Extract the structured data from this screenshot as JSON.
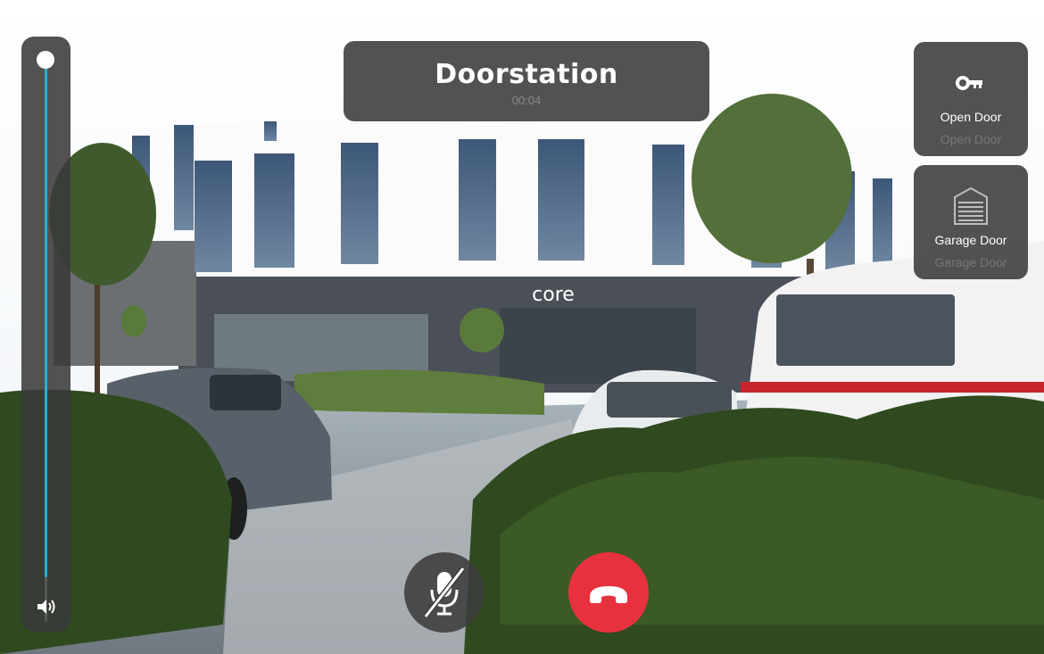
{
  "call": {
    "title": "Doorstation",
    "timer": "00:04"
  },
  "volume": {
    "level": 1.0,
    "icon": "speaker-volume-icon"
  },
  "actions": [
    {
      "label": "Open Door",
      "sublabel": "Open Door",
      "icon": "key-icon"
    },
    {
      "label": "Garage Door",
      "sublabel": "Garage Door",
      "icon": "garage-door-icon"
    }
  ],
  "controls": {
    "mute": {
      "icon": "microphone-muted-icon",
      "state": "muted"
    },
    "hangup": {
      "icon": "hang-up-phone-icon",
      "color": "#e8313f"
    }
  },
  "camera": {
    "sign_text": "core"
  },
  "colors": {
    "accent": "#27b2cc",
    "panel": "#3a3a3a",
    "hangup": "#e8313f"
  }
}
